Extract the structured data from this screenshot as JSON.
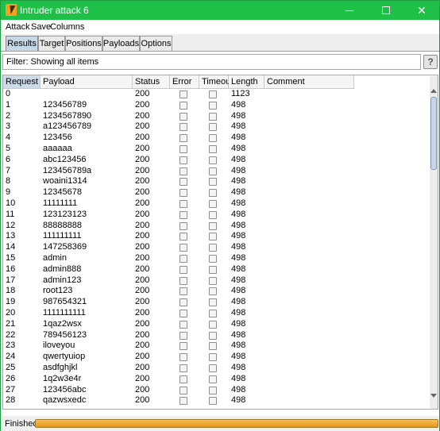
{
  "window": {
    "title": "Intruder attack 6",
    "min_icon": "minimize-icon",
    "max_icon": "maximize-icon",
    "close_icon": "close-icon",
    "close_glyph": "✕"
  },
  "menu": [
    "Attack",
    "Save",
    "Columns"
  ],
  "tabs": [
    "Results",
    "Target",
    "Positions",
    "Payloads",
    "Options"
  ],
  "active_tab": "Results",
  "filter": {
    "text": "Filter: Showing all items",
    "help_label": "?"
  },
  "table": {
    "columns": [
      "Request",
      "Payload",
      "Status",
      "Error",
      "Timeout",
      "Length",
      "Comment"
    ],
    "sorted_column": "Request",
    "sort_direction": "ascending",
    "rows": [
      {
        "request": "0",
        "payload": "",
        "status": "200",
        "length": "1123"
      },
      {
        "request": "1",
        "payload": "123456789",
        "status": "200",
        "length": "498"
      },
      {
        "request": "2",
        "payload": "1234567890",
        "status": "200",
        "length": "498"
      },
      {
        "request": "3",
        "payload": "a123456789",
        "status": "200",
        "length": "498"
      },
      {
        "request": "4",
        "payload": "123456",
        "status": "200",
        "length": "498"
      },
      {
        "request": "5",
        "payload": "aaaaaa",
        "status": "200",
        "length": "498"
      },
      {
        "request": "6",
        "payload": "abc123456",
        "status": "200",
        "length": "498"
      },
      {
        "request": "7",
        "payload": "123456789a",
        "status": "200",
        "length": "498"
      },
      {
        "request": "8",
        "payload": "woaini1314",
        "status": "200",
        "length": "498"
      },
      {
        "request": "9",
        "payload": "12345678",
        "status": "200",
        "length": "498"
      },
      {
        "request": "10",
        "payload": "11111111",
        "status": "200",
        "length": "498"
      },
      {
        "request": "11",
        "payload": "123123123",
        "status": "200",
        "length": "498"
      },
      {
        "request": "12",
        "payload": "88888888",
        "status": "200",
        "length": "498"
      },
      {
        "request": "13",
        "payload": "111111111",
        "status": "200",
        "length": "498"
      },
      {
        "request": "14",
        "payload": "147258369",
        "status": "200",
        "length": "498"
      },
      {
        "request": "15",
        "payload": "admin",
        "status": "200",
        "length": "498"
      },
      {
        "request": "16",
        "payload": "admin888",
        "status": "200",
        "length": "498"
      },
      {
        "request": "17",
        "payload": "admin123",
        "status": "200",
        "length": "498"
      },
      {
        "request": "18",
        "payload": "root123",
        "status": "200",
        "length": "498"
      },
      {
        "request": "19",
        "payload": "987654321",
        "status": "200",
        "length": "498"
      },
      {
        "request": "20",
        "payload": "1111111111",
        "status": "200",
        "length": "498"
      },
      {
        "request": "21",
        "payload": "1qaz2wsx",
        "status": "200",
        "length": "498"
      },
      {
        "request": "22",
        "payload": "789456123",
        "status": "200",
        "length": "498"
      },
      {
        "request": "23",
        "payload": "iloveyou",
        "status": "200",
        "length": "498"
      },
      {
        "request": "24",
        "payload": "qwertyuiop",
        "status": "200",
        "length": "498"
      },
      {
        "request": "25",
        "payload": "asdfghjkl",
        "status": "200",
        "length": "498"
      },
      {
        "request": "26",
        "payload": "1q2w3e4r",
        "status": "200",
        "length": "498"
      },
      {
        "request": "27",
        "payload": "123456abc",
        "status": "200",
        "length": "498"
      },
      {
        "request": "28",
        "payload": "qazwsxedc",
        "status": "200",
        "length": "498"
      }
    ]
  },
  "status": {
    "text": "Finished",
    "progress": 1.0
  }
}
